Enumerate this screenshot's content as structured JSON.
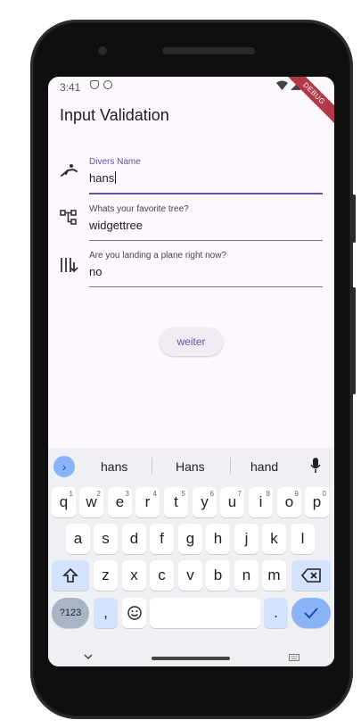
{
  "status": {
    "time": "3:41",
    "debug_label": "DEBUG"
  },
  "app": {
    "title": "Input Validation"
  },
  "fields": [
    {
      "label": "Divers Name",
      "value": "hans",
      "icon": "diver-icon"
    },
    {
      "label": "Whats your favorite tree?",
      "value": "widgettree",
      "icon": "tree-structure-icon"
    },
    {
      "label": "Are you landing a plane right now?",
      "value": "no",
      "icon": "flight-landing-icon"
    }
  ],
  "buttons": {
    "submit": "weiter"
  },
  "keyboard": {
    "suggestions": [
      "hans",
      "Hans",
      "hand"
    ],
    "row1": [
      "q",
      "w",
      "e",
      "r",
      "t",
      "y",
      "u",
      "i",
      "o",
      "p"
    ],
    "row1_hints": [
      "1",
      "2",
      "3",
      "4",
      "5",
      "6",
      "7",
      "8",
      "9",
      "0"
    ],
    "row2": [
      "a",
      "s",
      "d",
      "f",
      "g",
      "h",
      "j",
      "k",
      "l"
    ],
    "row3": [
      "z",
      "x",
      "c",
      "v",
      "b",
      "n",
      "m"
    ],
    "symbols_key": "?123",
    "comma": ",",
    "period": "."
  },
  "colors": {
    "accent": "#6750a4",
    "screen_bg": "#fdf7fe",
    "keyboard_bg": "#eef0f4"
  }
}
